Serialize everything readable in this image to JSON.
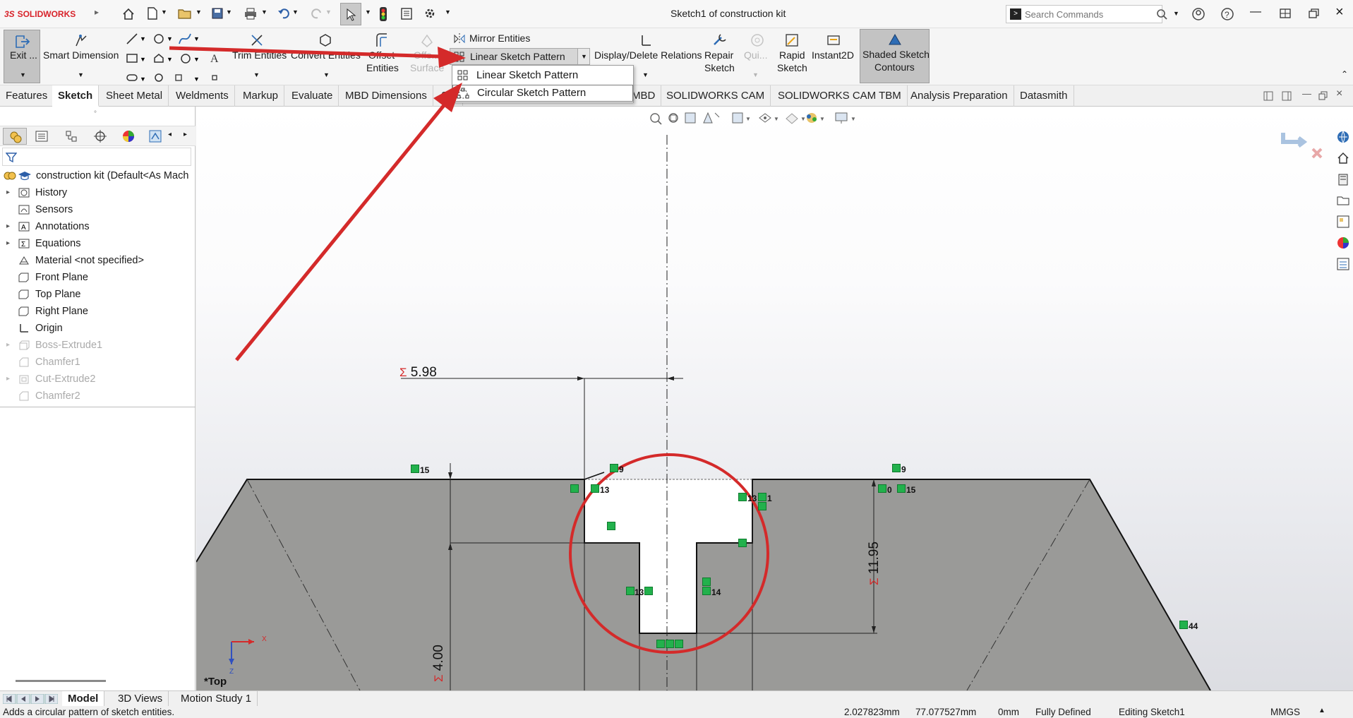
{
  "app": {
    "logo_text": "SOLIDWORKS",
    "window_title": "Sketch1 of construction kit"
  },
  "search": {
    "placeholder": "Search Commands"
  },
  "ribbon": {
    "exit_sketch": "Exit ...",
    "smart_dimension": "Smart Dimension",
    "trim_entities": "Trim Entities",
    "convert_entities": "Convert Entities",
    "offset_entities_1": "Offset",
    "offset_entities_2": "Entities",
    "offset_surface_1": "Offs...",
    "offset_surface_2": "Surface",
    "mirror_entities": "Mirror Entities",
    "linear_sketch_pattern": "Linear Sketch Pattern",
    "display_delete_relations": "Display/Delete Relations",
    "repair_sketch_1": "Repair",
    "repair_sketch_2": "Sketch",
    "quick_snaps": "Qui...",
    "rapid_sketch_1": "Rapid",
    "rapid_sketch_2": "Sketch",
    "instant2d": "Instant2D",
    "shaded_contours_1": "Shaded Sketch",
    "shaded_contours_2": "Contours"
  },
  "dropdown": {
    "items": [
      "Linear Sketch Pattern",
      "Circular Sketch Pattern"
    ]
  },
  "tabs": [
    "Features",
    "Sketch",
    "Sheet Metal",
    "Weldments",
    "Markup",
    "Evaluate",
    "MBD Dimensions",
    "SO",
    "MBD",
    "SOLIDWORKS CAM",
    "SOLIDWORKS CAM TBM",
    "Analysis Preparation",
    "Datasmith"
  ],
  "active_tab": "Sketch",
  "tree": {
    "root": "construction kit  (Default<As Mach",
    "items": [
      {
        "label": "History",
        "expandable": true,
        "suppressed": false
      },
      {
        "label": "Sensors",
        "expandable": false,
        "suppressed": false
      },
      {
        "label": "Annotations",
        "expandable": true,
        "suppressed": false
      },
      {
        "label": "Equations",
        "expandable": true,
        "suppressed": false
      },
      {
        "label": "Material <not specified>",
        "expandable": false,
        "suppressed": false
      },
      {
        "label": "Front Plane",
        "expandable": false,
        "suppressed": false
      },
      {
        "label": "Top Plane",
        "expandable": false,
        "suppressed": false
      },
      {
        "label": "Right Plane",
        "expandable": false,
        "suppressed": false
      },
      {
        "label": "Origin",
        "expandable": false,
        "suppressed": false
      },
      {
        "label": "Boss-Extrude1",
        "expandable": true,
        "suppressed": true
      },
      {
        "label": "Chamfer1",
        "expandable": false,
        "suppressed": true
      },
      {
        "label": "Cut-Extrude2",
        "expandable": true,
        "suppressed": true
      },
      {
        "label": "Chamfer2",
        "expandable": false,
        "suppressed": true
      }
    ]
  },
  "sketch": {
    "dim_width": "5.98",
    "dim_height": "11.95",
    "dim_depth": "4.00",
    "view_label": "*Top",
    "relations": [
      "15",
      "9",
      "13",
      "13",
      "1",
      "13",
      "14",
      "9",
      "0",
      "15",
      "44"
    ]
  },
  "bottom_tabs": [
    "Model",
    "3D Views",
    "Motion Study 1"
  ],
  "active_bottom_tab": "Model",
  "status": {
    "message": "Adds a circular pattern of sketch entities.",
    "x": "2.027823mm",
    "y": "77.077527mm",
    "z": "0mm",
    "state": "Fully Defined",
    "editing": "Editing Sketch1",
    "units": "MMGS"
  },
  "colors": {
    "annotation_red": "#d42a2a",
    "relation_green": "#22b14c",
    "model_gray": "#9a9a98",
    "brand_red": "#d8232a"
  }
}
